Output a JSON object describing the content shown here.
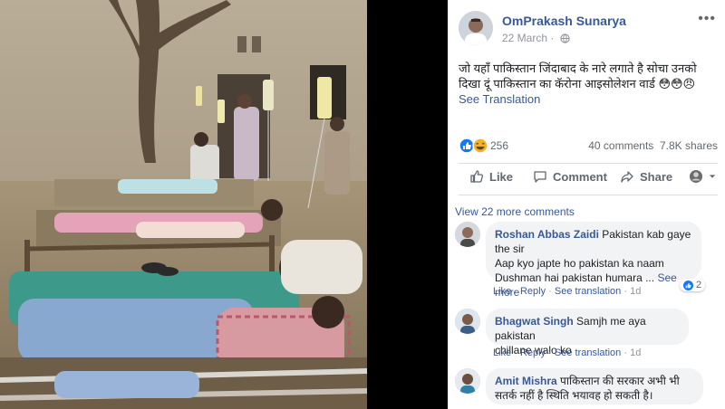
{
  "photo": {
    "icon": "hospital-ward-photo"
  },
  "post": {
    "author": "OmPrakash Sunarya",
    "date": "22 March",
    "separator": "·",
    "more_label": "•••",
    "text": "जो यहाँ पाकिस्तान जिंदाबाद के नारे लगाते है सोचा उनको दिखा दूं पाकिस्तान का कॅरोना आइसोलेशन वार्ड 😳😳😠",
    "see_translation": "See Translation"
  },
  "stats": {
    "reaction_count": "256",
    "comments": "40 comments",
    "shares": "7.8K shares"
  },
  "actions": {
    "like": "Like",
    "comment": "Comment",
    "share": "Share"
  },
  "view_more": "View 22 more comments",
  "comments": [
    {
      "name": "Roshan Abbas Zaidi",
      "text_first": "Pakistan kab gaye",
      "line2": "the sir",
      "line3": "Aap kyo japte ho pakistan ka naam",
      "line4": "Dushman hai pakistan humara ...",
      "see_more": "See more",
      "like": "Like",
      "reply": "Reply",
      "see_translation": "See translation",
      "time": "1d",
      "likes": "2"
    },
    {
      "name": "Bhagwat Singh",
      "text_first": "Samjh me aya pakistan",
      "line2": "chillane walo ko",
      "like": "Like",
      "reply": "Reply",
      "see_translation": "See translation",
      "time": "1d"
    },
    {
      "name": "Amit Mishra",
      "text_first": "पाकिस्तान की सरकार अभी भी",
      "line2": "सतर्क नहीं है स्थिति भयावह हो सकती है।"
    }
  ],
  "colors": {
    "link": "#385898",
    "muted": "#90949c",
    "bubble": "#f2f3f5",
    "like_blue": "#1877f2"
  }
}
